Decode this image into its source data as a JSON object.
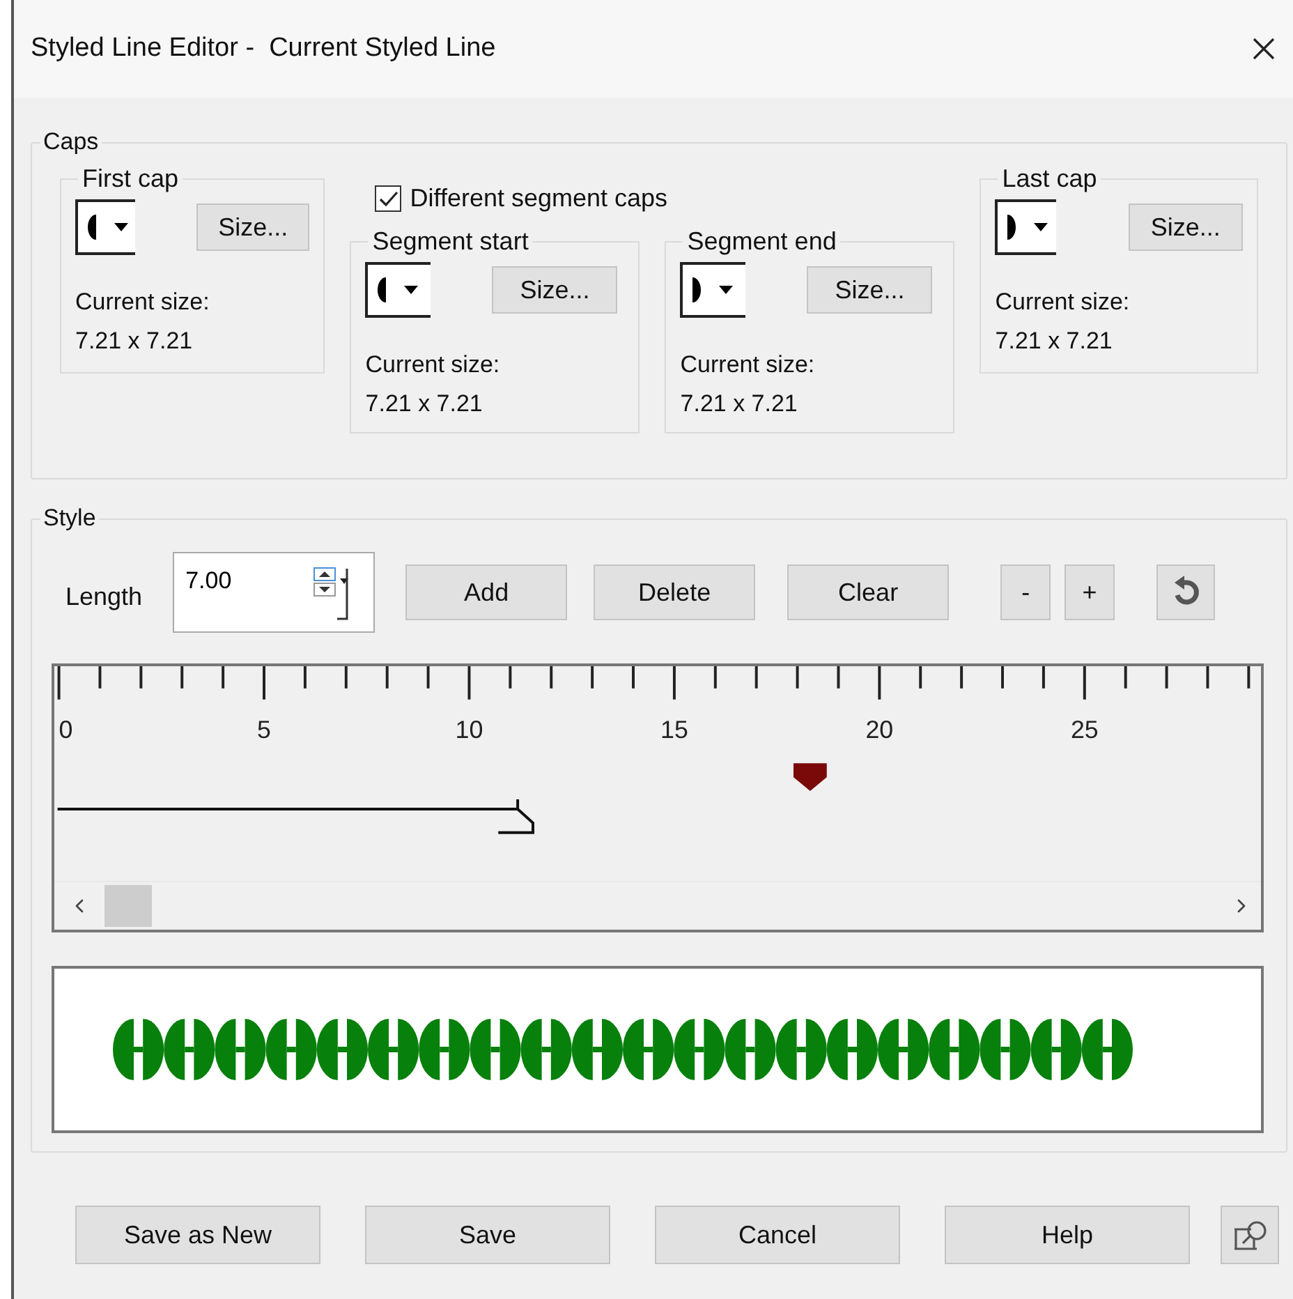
{
  "window": {
    "title": "Styled Line Editor -  Current Styled Line"
  },
  "caps": {
    "title": "Caps",
    "first_cap": {
      "title": "First cap",
      "kind": "left-half",
      "size_button": "Size...",
      "size_label": "Current size:",
      "size_value": "7.21 x 7.21"
    },
    "different_segment_caps": {
      "label": "Different segment caps",
      "checked": true
    },
    "segment_start": {
      "title": "Segment start",
      "kind": "left-half",
      "size_button": "Size...",
      "size_label": "Current size:",
      "size_value": "7.21 x 7.21"
    },
    "segment_end": {
      "title": "Segment end",
      "kind": "right-half",
      "size_button": "Size...",
      "size_label": "Current size:",
      "size_value": "7.21 x 7.21"
    },
    "last_cap": {
      "title": "Last cap",
      "kind": "right-half",
      "size_button": "Size...",
      "size_label": "Current size:",
      "size_value": "7.21 x 7.21"
    }
  },
  "style": {
    "title": "Style",
    "length_label": "Length",
    "length_value": "7.00",
    "buttons": [
      "Add",
      "Delete",
      "Clear"
    ],
    "step_buttons": [
      "-",
      "+"
    ],
    "ruler_labels": [
      "0",
      "5",
      "10",
      "15",
      "20",
      "25"
    ]
  },
  "buttons": [
    "Save as New",
    "Save",
    "Cancel",
    "Help"
  ]
}
